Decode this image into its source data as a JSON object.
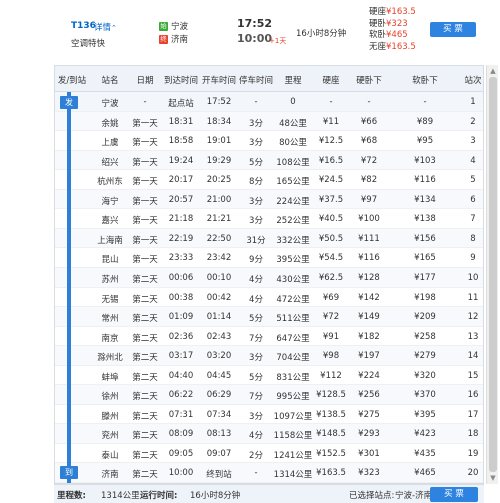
{
  "header": {
    "train_no": "T136",
    "detail_link": "详情",
    "train_type": "空调特快",
    "from_badge": "始",
    "from_station": "宁波",
    "to_badge": "终",
    "to_station": "济南",
    "depart_time": "17:52",
    "arrive_time": "10:00",
    "day_offset": "+1天",
    "duration": "16小时8分钟",
    "prices": [
      {
        "label": "硬座",
        "value": "¥163.5"
      },
      {
        "label": "硬卧",
        "value": "¥323"
      },
      {
        "label": "软卧",
        "value": "¥465"
      },
      {
        "label": "无座",
        "value": "¥163.5"
      }
    ],
    "buy_label": "买 票"
  },
  "grid": {
    "columns": [
      "发/到站",
      "站名",
      "日期",
      "到达时间",
      "开车时间",
      "停车时间",
      "里程",
      "硬座",
      "硬卧下",
      "软卧下",
      "站次"
    ],
    "start_tag": "发",
    "end_tag": "到",
    "rows": [
      [
        "宁波",
        "-",
        "起点站",
        "17:52",
        "-",
        "0",
        "-",
        "-",
        "-",
        "1"
      ],
      [
        "余姚",
        "第一天",
        "18:31",
        "18:34",
        "3分",
        "48公里",
        "¥11",
        "¥66",
        "¥89",
        "2"
      ],
      [
        "上虞",
        "第一天",
        "18:58",
        "19:01",
        "3分",
        "80公里",
        "¥12.5",
        "¥68",
        "¥95",
        "3"
      ],
      [
        "绍兴",
        "第一天",
        "19:24",
        "19:29",
        "5分",
        "108公里",
        "¥16.5",
        "¥72",
        "¥103",
        "4"
      ],
      [
        "杭州东",
        "第一天",
        "20:17",
        "20:25",
        "8分",
        "165公里",
        "¥24.5",
        "¥82",
        "¥116",
        "5"
      ],
      [
        "海宁",
        "第一天",
        "20:57",
        "21:00",
        "3分",
        "224公里",
        "¥37.5",
        "¥97",
        "¥134",
        "6"
      ],
      [
        "嘉兴",
        "第一天",
        "21:18",
        "21:21",
        "3分",
        "252公里",
        "¥40.5",
        "¥100",
        "¥138",
        "7"
      ],
      [
        "上海南",
        "第一天",
        "22:19",
        "22:50",
        "31分",
        "332公里",
        "¥50.5",
        "¥111",
        "¥156",
        "8"
      ],
      [
        "昆山",
        "第一天",
        "23:33",
        "23:42",
        "9分",
        "395公里",
        "¥54.5",
        "¥116",
        "¥165",
        "9"
      ],
      [
        "苏州",
        "第二天",
        "00:06",
        "00:10",
        "4分",
        "430公里",
        "¥62.5",
        "¥128",
        "¥177",
        "10"
      ],
      [
        "无锡",
        "第二天",
        "00:38",
        "00:42",
        "4分",
        "472公里",
        "¥69",
        "¥142",
        "¥198",
        "11"
      ],
      [
        "常州",
        "第二天",
        "01:09",
        "01:14",
        "5分",
        "511公里",
        "¥72",
        "¥149",
        "¥209",
        "12"
      ],
      [
        "南京",
        "第二天",
        "02:36",
        "02:43",
        "7分",
        "647公里",
        "¥91",
        "¥182",
        "¥258",
        "13"
      ],
      [
        "滁州北",
        "第二天",
        "03:17",
        "03:20",
        "3分",
        "704公里",
        "¥98",
        "¥197",
        "¥279",
        "14"
      ],
      [
        "蚌埠",
        "第二天",
        "04:40",
        "04:45",
        "5分",
        "831公里",
        "¥112",
        "¥224",
        "¥320",
        "15"
      ],
      [
        "徐州",
        "第二天",
        "06:22",
        "06:29",
        "7分",
        "995公里",
        "¥128.5",
        "¥256",
        "¥370",
        "16"
      ],
      [
        "滕州",
        "第二天",
        "07:31",
        "07:34",
        "3分",
        "1097公里",
        "¥138.5",
        "¥275",
        "¥395",
        "17"
      ],
      [
        "兖州",
        "第二天",
        "08:09",
        "08:13",
        "4分",
        "1158公里",
        "¥148.5",
        "¥293",
        "¥423",
        "18"
      ],
      [
        "泰山",
        "第二天",
        "09:05",
        "09:07",
        "2分",
        "1241公里",
        "¥152.5",
        "¥301",
        "¥435",
        "19"
      ],
      [
        "济南",
        "第二天",
        "10:00",
        "终到站",
        "-",
        "1314公里",
        "¥163.5",
        "¥323",
        "¥465",
        "20"
      ]
    ]
  },
  "footer": {
    "mileage_label": "里程数:",
    "mileage_value": "1314公里",
    "runtime_label": "运行时间:",
    "runtime_value": "16小时8分钟",
    "selected_label": "已选择站点:",
    "selected_value": "宁波-济南",
    "buy_label": "买 票"
  }
}
